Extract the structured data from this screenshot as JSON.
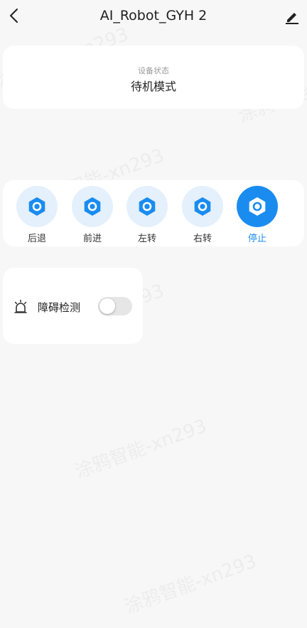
{
  "header": {
    "title": "AI_Robot_GYH 2",
    "back_icon": "chevron-left-icon",
    "edit_icon": "pencil-icon"
  },
  "status": {
    "label": "设备状态",
    "value": "待机模式"
  },
  "controls": [
    {
      "label": "后退",
      "icon": "hexagon-icon",
      "active": false
    },
    {
      "label": "前进",
      "icon": "hexagon-icon",
      "active": false
    },
    {
      "label": "左转",
      "icon": "hexagon-icon",
      "active": false
    },
    {
      "label": "右转",
      "icon": "hexagon-icon",
      "active": false
    },
    {
      "label": "停止",
      "icon": "hexagon-icon",
      "active": true
    }
  ],
  "obstacle": {
    "label": "障碍检测",
    "icon": "alarm-icon",
    "enabled": false
  },
  "watermark": "涂鸦智能-xn293",
  "colors": {
    "accent": "#1a8cf0",
    "accent_light": "#e4f0fc",
    "background": "#f7f7f7"
  }
}
